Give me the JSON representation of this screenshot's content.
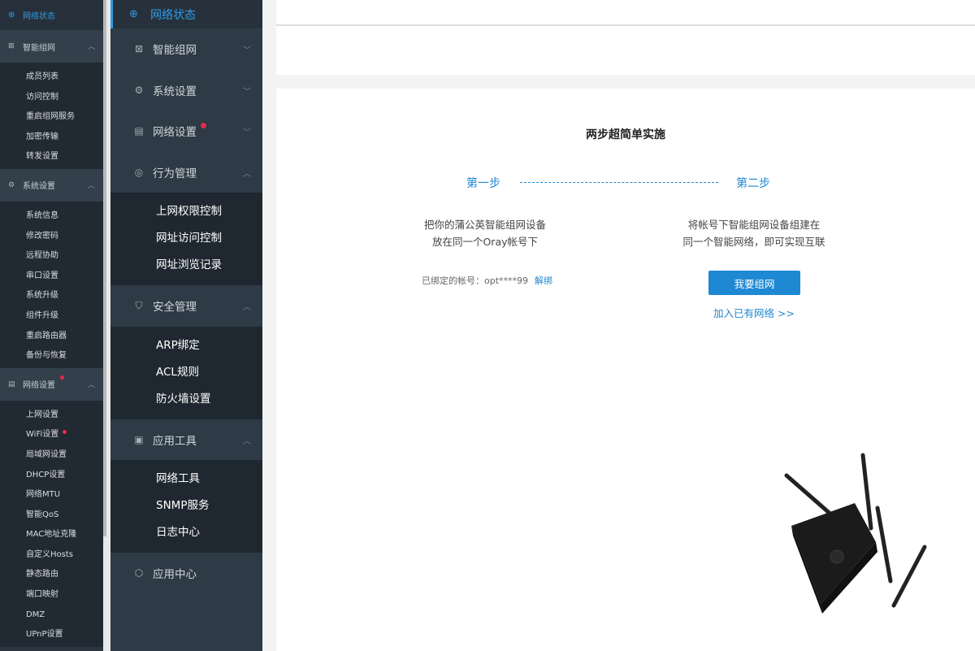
{
  "left_sidebar": {
    "top": "网络状态",
    "groups": [
      {
        "label": "智能组网",
        "items": [
          "成员列表",
          "访问控制",
          "重启组网服务",
          "加密传输",
          "转发设置"
        ]
      },
      {
        "label": "系统设置",
        "items": [
          "系统信息",
          "修改密码",
          "远程协助",
          "串口设置",
          "系统升级",
          "组件升级",
          "重启路由器",
          "备份与恢复"
        ]
      },
      {
        "label": "网络设置",
        "items": [
          "上网设置",
          "WiFi设置",
          "局域网设置",
          "DHCP设置",
          "网络MTU",
          "智能QoS",
          "MAC地址克隆",
          "自定义Hosts",
          "静态路由",
          "端口映射",
          "DMZ",
          "UPnP设置"
        ]
      }
    ]
  },
  "main_sidebar": {
    "top": "网络状态",
    "groups": [
      {
        "label": "智能组网"
      },
      {
        "label": "系统设置"
      },
      {
        "label": "网络设置"
      },
      {
        "label": "行为管理",
        "items": [
          "上网权限控制",
          "网址访问控制",
          "网址浏览记录"
        ]
      },
      {
        "label": "安全管理",
        "items": [
          "ARP绑定",
          "ACL规则",
          "防火墙设置"
        ]
      },
      {
        "label": "应用工具",
        "items": [
          "网络工具",
          "SNMP服务",
          "日志中心"
        ]
      },
      {
        "label": "应用中心"
      }
    ]
  },
  "content": {
    "title": "两步超简单实施",
    "step1": "第一步",
    "step2": "第二步",
    "step1_desc_line1": "把你的蒲公英智能组网设备",
    "step1_desc_line2": "放在同一个Oray帐号下",
    "step2_desc_line1": "将帐号下智能组网设备组建在",
    "step2_desc_line2": "同一个智能网络，即可实现互联",
    "bound_label": "已绑定的帐号：opt****99",
    "unbind": "解绑",
    "create_button": "我要组网",
    "join_link": "加入已有网络 >>"
  },
  "colors": {
    "accent": "#1e88d2",
    "sidebar_bg": "#2e3a45",
    "submenu_bg": "#1f2830",
    "badge": "#e6294f"
  }
}
